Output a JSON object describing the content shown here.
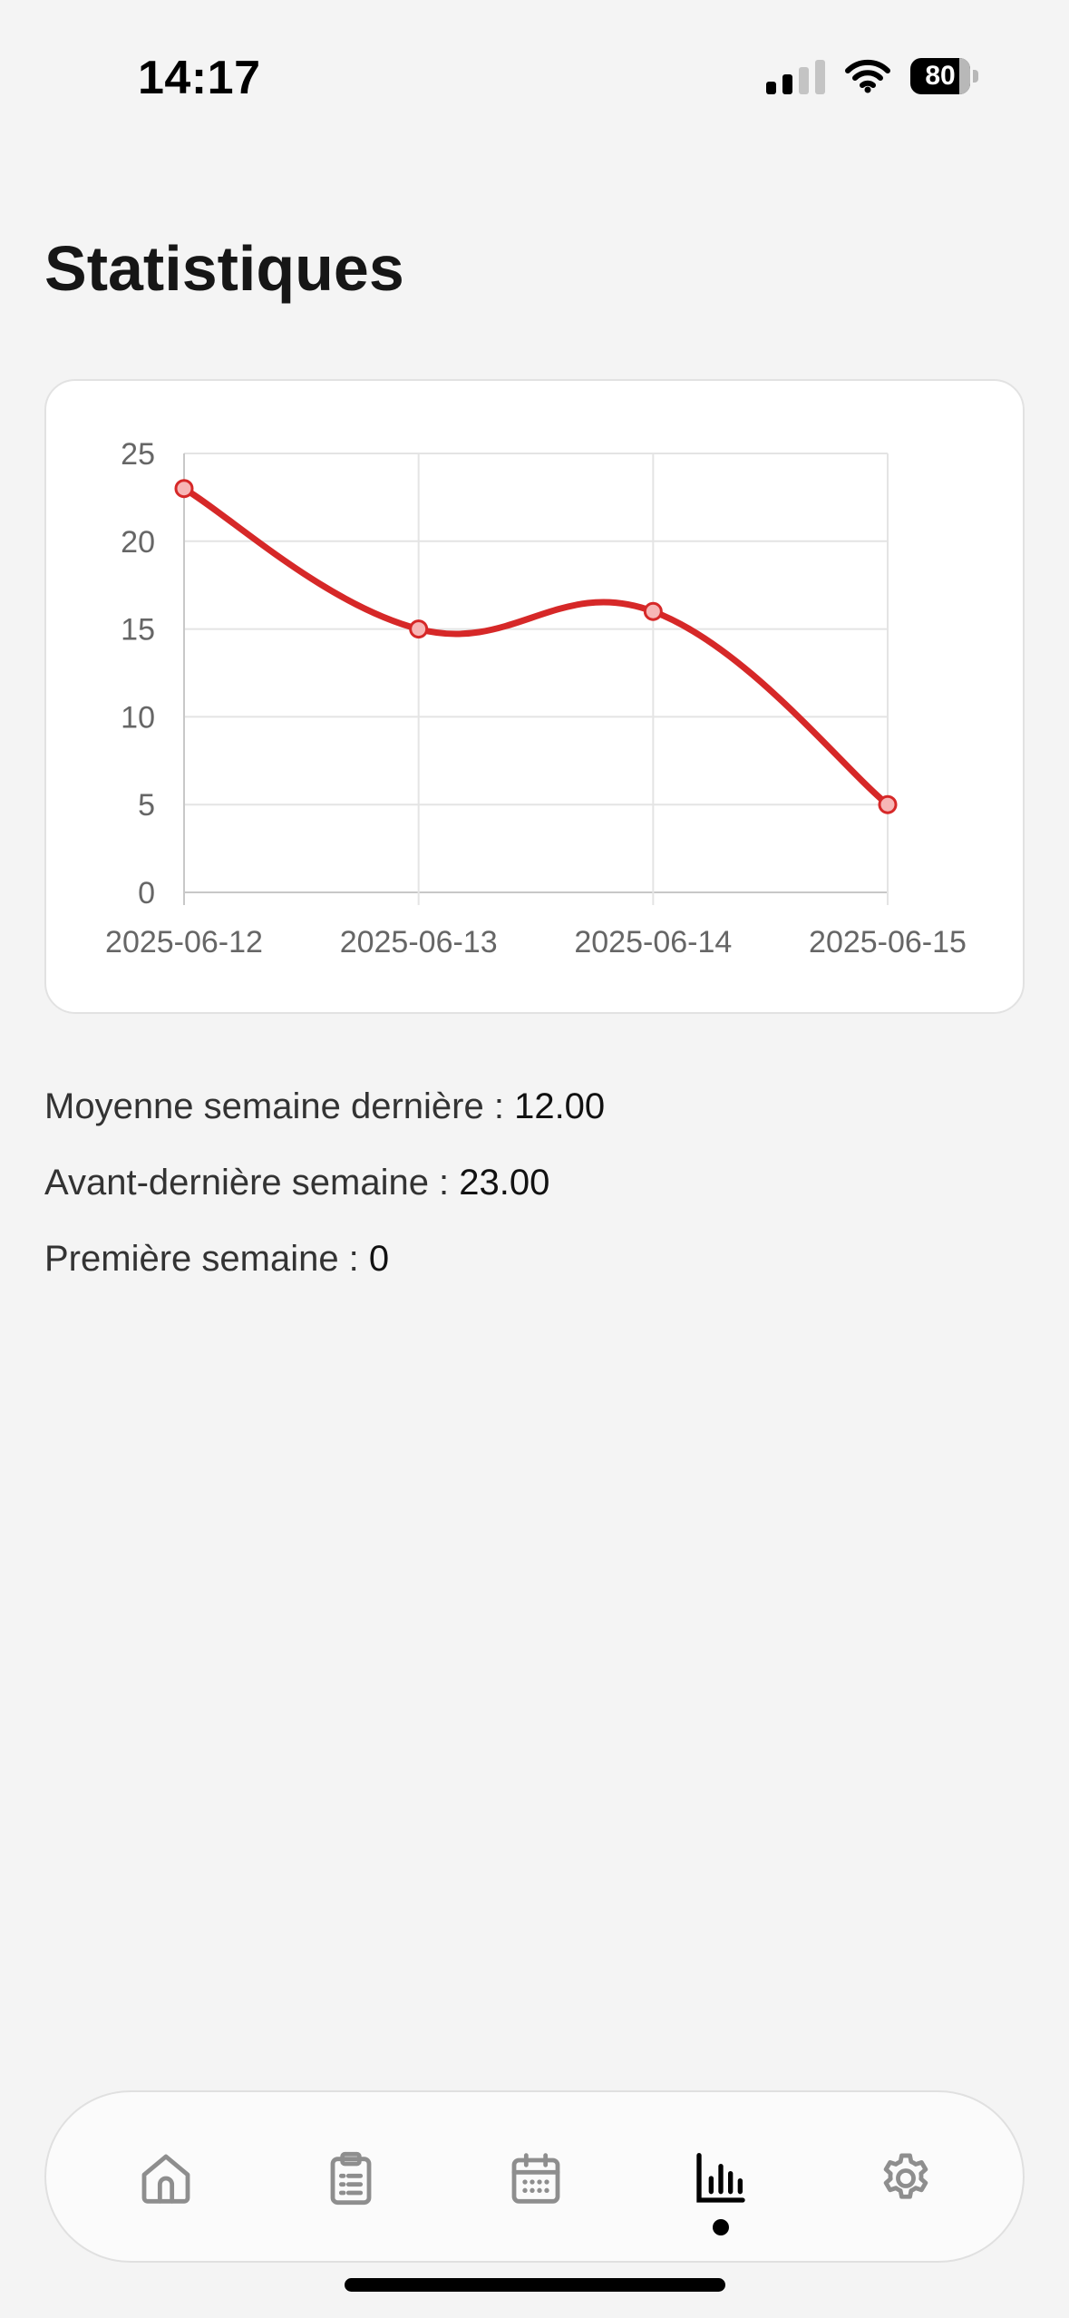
{
  "status_bar": {
    "time": "14:17",
    "battery": "80"
  },
  "page": {
    "title": "Statistiques"
  },
  "chart_data": {
    "type": "line",
    "categories": [
      "2025-06-12",
      "2025-06-13",
      "2025-06-14",
      "2025-06-15"
    ],
    "values": [
      23,
      15,
      16,
      5
    ],
    "ylim": [
      0,
      25
    ],
    "yticks": [
      "0",
      "5",
      "10",
      "15",
      "20",
      "25"
    ],
    "grid": true,
    "line_color": "#d62828",
    "point_fill": "#f7b6b6",
    "title": "",
    "xlabel": "",
    "ylabel": ""
  },
  "stats": [
    {
      "label": "Moyenne semaine dernière : ",
      "value": "12.00"
    },
    {
      "label": "Avant-dernière semaine : ",
      "value": "23.00"
    },
    {
      "label": "Première semaine : ",
      "value": "0"
    }
  ],
  "tab_bar": {
    "tabs": [
      {
        "icon": "home-icon",
        "active": false
      },
      {
        "icon": "clipboard-list-icon",
        "active": false
      },
      {
        "icon": "calendar-icon",
        "active": false
      },
      {
        "icon": "bar-chart-icon",
        "active": true
      },
      {
        "icon": "gear-icon",
        "active": false
      }
    ],
    "active_color": "#000000",
    "inactive_color": "#8e8e8e"
  }
}
